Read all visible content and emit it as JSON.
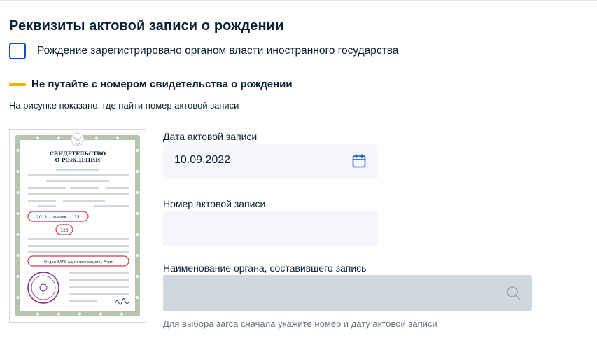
{
  "section": {
    "title": "Реквизиты актовой записи о рождении"
  },
  "foreign_checkbox": {
    "label": "Рождение зарегистрировано органом власти иностранного государства",
    "checked": false,
    "color": "#0d4cd3"
  },
  "warning": {
    "text": "Не путайте с номером свидетельства о рождении",
    "accent_color": "#edb500"
  },
  "hint": {
    "text": "На рисунке показано, где найти номер актовой записи"
  },
  "certificate": {
    "title_line1": "СВИДЕТЕЛЬСТВО",
    "title_line2": "О РОЖДЕНИИ",
    "date_year": "2012",
    "date_month": "января",
    "date_day": "15",
    "record_number": "123",
    "office": "Отдел ЗАГС администрации г. Ачит",
    "signature": "Ивин"
  },
  "fields": {
    "date": {
      "label": "Дата актовой записи",
      "value": "10.09.2022",
      "icon": "calendar-icon"
    },
    "number": {
      "label": "Номер актовой записи",
      "value": ""
    },
    "organ": {
      "label": "Наименование органа, составившего запись",
      "value": "",
      "icon": "search-icon",
      "disabled": true,
      "hint": "Для выбора загса сначала укажите номер и дату актовой записи"
    }
  }
}
